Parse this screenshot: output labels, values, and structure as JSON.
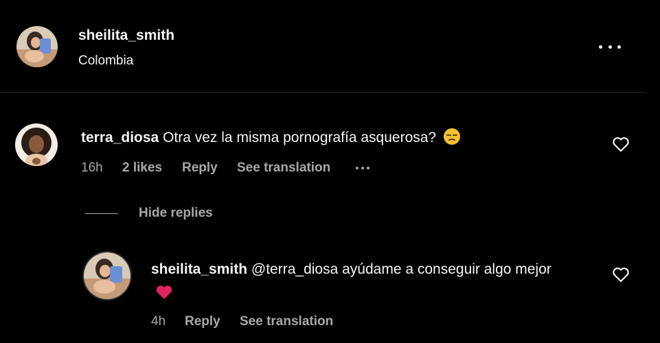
{
  "post": {
    "username": "sheilita_smith",
    "location": "Colombia",
    "more_icon": "more-horizontal-icon"
  },
  "comment": {
    "username": "terra_diosa",
    "text": "Otra vez la misma pornografía asquerosa?",
    "emoji": "unamused-face-emoji",
    "time": "16h",
    "likes": "2 likes",
    "reply_label": "Reply",
    "see_translation_label": "See translation"
  },
  "hide_replies_label": "Hide replies",
  "reply": {
    "username": "sheilita_smith",
    "text": "@terra_diosa ayúdame a conseguir algo mejor",
    "emoji": "red-heart-emoji",
    "time": "4h",
    "reply_label": "Reply",
    "see_translation_label": "See translation"
  },
  "colors": {
    "background": "#000000",
    "primary_text": "#f5f5f5",
    "secondary_text": "#a8a8a8",
    "heart_red": "#e0245e"
  }
}
